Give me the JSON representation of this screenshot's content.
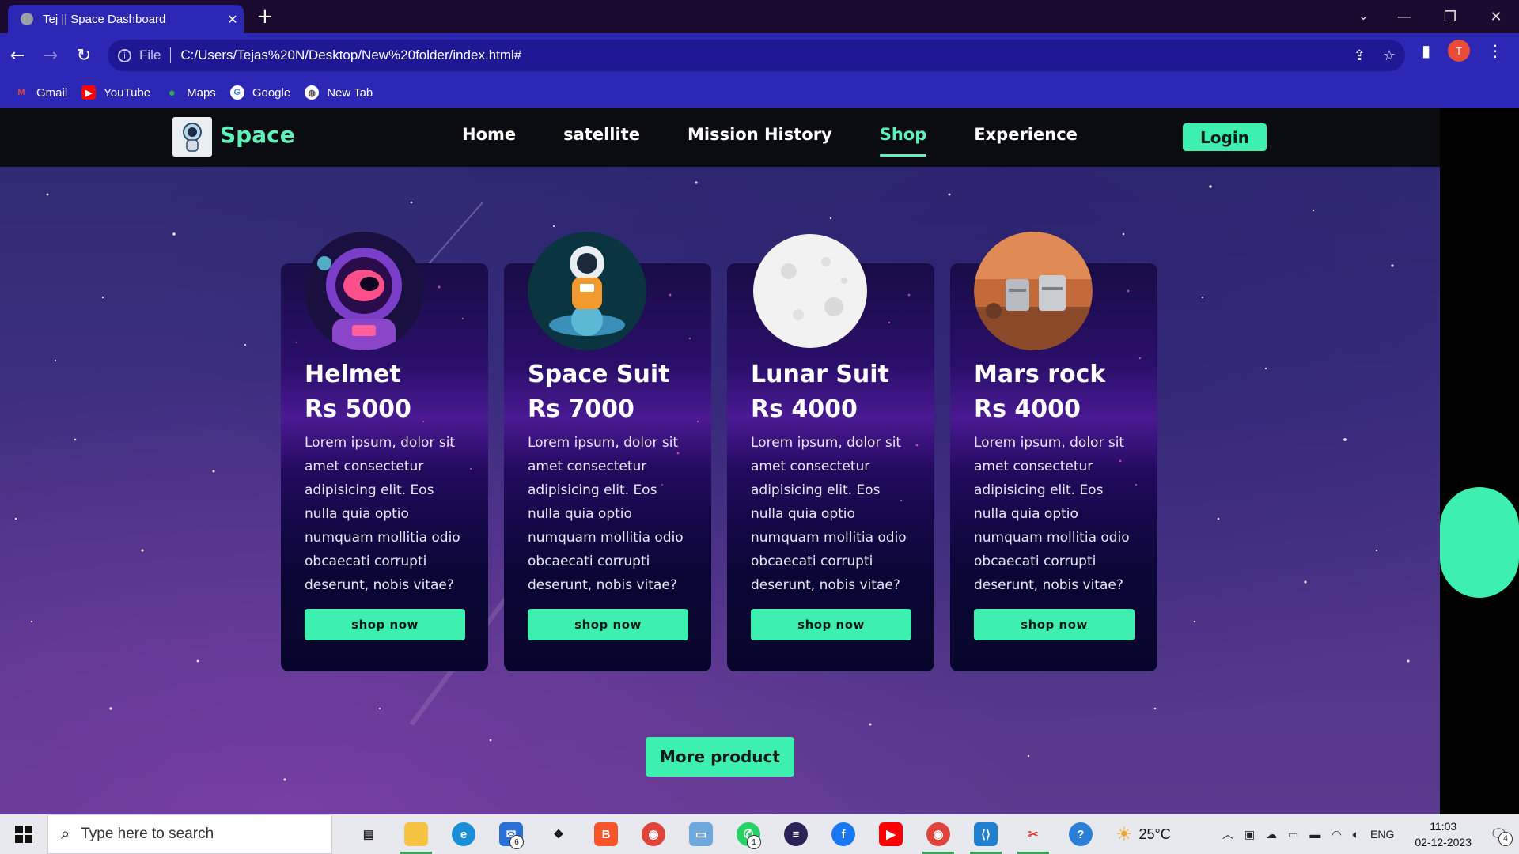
{
  "browser": {
    "tab_title": "Tej || Space Dashboard",
    "url_scheme": "File",
    "url": "C:/Users/Tejas%20N/Desktop/New%20folder/index.html#",
    "profile_initial": "T",
    "bookmarks": [
      "Gmail",
      "YouTube",
      "Maps",
      "Google",
      "New Tab"
    ]
  },
  "site": {
    "logo_text": "Space",
    "nav": [
      "Home",
      "satellite",
      "Mission History",
      "Shop",
      "Experience"
    ],
    "active_nav": "Shop",
    "login_label": "Login",
    "more_label": "More product",
    "accent_color": "#3ef0b0"
  },
  "products": [
    {
      "name": "Helmet",
      "price": "Rs 5000",
      "description": "Lorem ipsum, dolor sit amet consectetur adipisicing elit. Eos nulla quia optio numquam mollitia odio obcaecati corrupti deserunt, nobis vitae?",
      "button": "shop now",
      "image": "astronaut-helmet"
    },
    {
      "name": "Space Suit",
      "price": "Rs 7000",
      "description": "Lorem ipsum, dolor sit amet consectetur adipisicing elit. Eos nulla quia optio numquam mollitia odio obcaecati corrupti deserunt, nobis vitae?",
      "button": "shop now",
      "image": "astronaut-on-planet"
    },
    {
      "name": "Lunar Suit",
      "price": "Rs 4000",
      "description": "Lorem ipsum, dolor sit amet consectetur adipisicing elit. Eos nulla quia optio numquam mollitia odio obcaecati corrupti deserunt, nobis vitae?",
      "button": "shop now",
      "image": "moon"
    },
    {
      "name": "Mars rock",
      "price": "Rs 4000",
      "description": "Lorem ipsum, dolor sit amet consectetur adipisicing elit. Eos nulla quia optio numquam mollitia odio obcaecati corrupti deserunt, nobis vitae?",
      "button": "shop now",
      "image": "mars-base"
    }
  ],
  "taskbar": {
    "search_placeholder": "Type here to search",
    "temperature": "25°C",
    "language": "ENG",
    "time": "11:03",
    "date": "02-12-2023",
    "mail_badge": "6",
    "whatsapp_badge": "1",
    "notification_badge": "4"
  }
}
